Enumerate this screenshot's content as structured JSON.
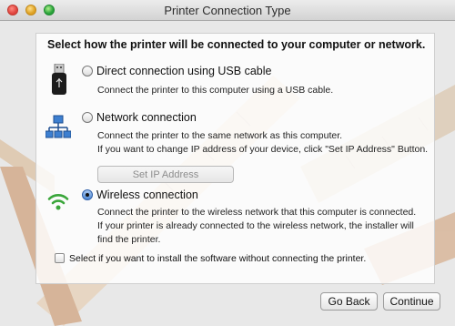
{
  "window": {
    "title": "Printer Connection Type"
  },
  "heading": "Select how the printer will be connected to your computer or network.",
  "options": [
    {
      "label": "Direct connection using USB cable",
      "icon": "usb-icon",
      "description": [
        "Connect the printer to this computer using a USB cable."
      ],
      "selected": false
    },
    {
      "label": "Network connection",
      "icon": "network-icon",
      "description": [
        "Connect the printer to the same network as this computer.",
        "If you want to change IP address of your device, click \"Set IP Address\" Button."
      ],
      "selected": false
    },
    {
      "label": "Wireless connection",
      "icon": "wifi-icon",
      "description": [
        "Connect the printer to the wireless network that this computer is connected.",
        "If your printer is already connected to the wireless network, the installer will",
        "find the printer."
      ],
      "selected": true
    }
  ],
  "set_ip_button": {
    "label": "Set IP Address",
    "enabled": false
  },
  "skip_checkbox": {
    "label": "Select if you want to install the software without connecting the printer.",
    "checked": false
  },
  "footer": {
    "back_label": "Go Back",
    "continue_label": "Continue"
  },
  "colors": {
    "wifi_green": "#3aa63a",
    "network_blue": "#3d7fd0",
    "radio_selected": "#4f88d3"
  }
}
